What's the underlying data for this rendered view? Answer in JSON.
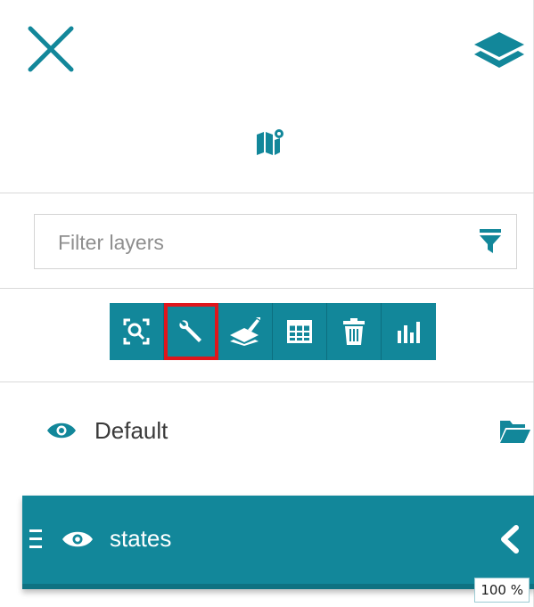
{
  "colors": {
    "accent": "#12879a",
    "accent_dark": "#0e7282",
    "highlight_outline": "#e0161c"
  },
  "header": {
    "close_icon": "close-icon",
    "layers_icon": "layers-icon",
    "map_icon": "map-marker-icon"
  },
  "filter": {
    "placeholder": "Filter layers",
    "value": "",
    "icon": "filter-icon"
  },
  "toolbar": {
    "items": [
      {
        "icon": "zoom-to-extent-icon",
        "highlighted": false
      },
      {
        "icon": "wrench-icon",
        "highlighted": true
      },
      {
        "icon": "style-brush-icon",
        "highlighted": false
      },
      {
        "icon": "attribute-table-icon",
        "highlighted": false
      },
      {
        "icon": "trash-icon",
        "highlighted": false
      },
      {
        "icon": "bar-chart-icon",
        "highlighted": false
      }
    ]
  },
  "groups": [
    {
      "label": "Default",
      "visible": true,
      "icon": "folder-open-icon"
    }
  ],
  "selected_layer": {
    "label": "states",
    "visible": true,
    "opacity": "100 %"
  }
}
